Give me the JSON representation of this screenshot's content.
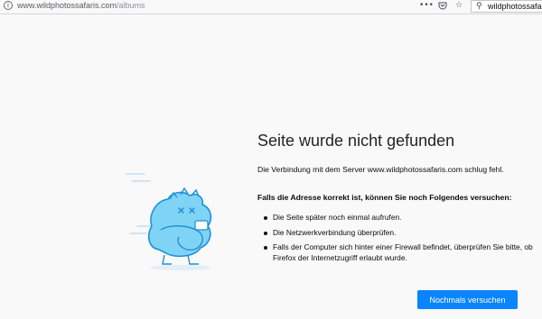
{
  "toolbar": {
    "info_glyph": "i",
    "url_host": "www.wildphotossafaris.com",
    "url_path": "/albums",
    "page_actions_icon": "ellipsis-icon",
    "pocket_icon": "pocket-icon",
    "bookmark_icon": "star-icon",
    "search_text": "wildphotossafari"
  },
  "error": {
    "title": "Seite wurde nicht gefunden",
    "description": "Die Verbindung mit dem Server www.wildphotossafaris.com schlug fehl.",
    "suggestions_heading": "Falls die Adresse korrekt ist, können Sie noch Folgendes versuchen:",
    "suggestions": [
      "Die Seite später noch einmal aufrufen.",
      "Die Netzwerkverbindung überprüfen.",
      "Falls der Computer sich hinter einer Firewall befindet, überprüfen Sie bitte, ob Firefox der Internetzugriff erlaubt wurde."
    ],
    "retry_label": "Nochmals versuchen"
  },
  "colors": {
    "accent": "#0a84ff",
    "background": "#f9f9fa",
    "illustration_fill": "#7fd4f5",
    "illustration_stroke": "#1e8fd6"
  }
}
